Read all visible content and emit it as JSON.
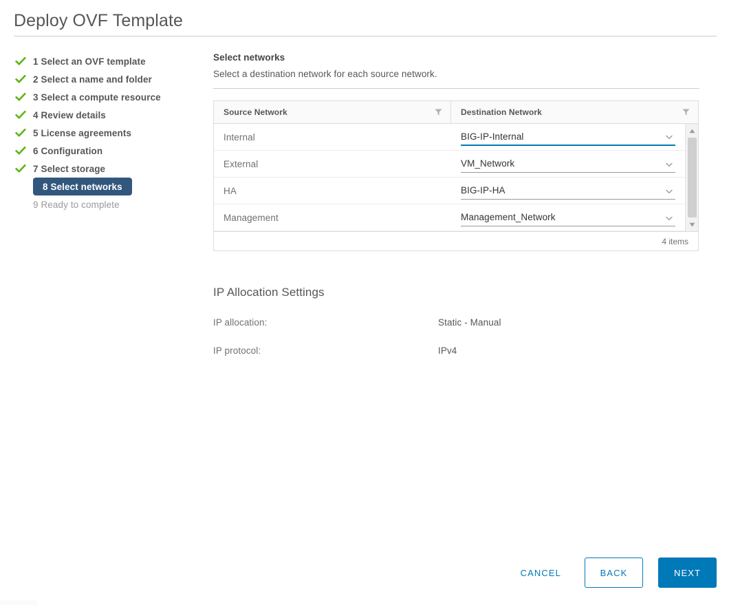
{
  "window": {
    "title": "Deploy OVF Template"
  },
  "steps": [
    {
      "number": "1",
      "label": "1 Select an OVF template",
      "state": "done"
    },
    {
      "number": "2",
      "label": "2 Select a name and folder",
      "state": "done"
    },
    {
      "number": "3",
      "label": "3 Select a compute resource",
      "state": "done"
    },
    {
      "number": "4",
      "label": "4 Review details",
      "state": "done"
    },
    {
      "number": "5",
      "label": "5 License agreements",
      "state": "done"
    },
    {
      "number": "6",
      "label": "6 Configuration",
      "state": "done"
    },
    {
      "number": "7",
      "label": "7 Select storage",
      "state": "done"
    },
    {
      "number": "8",
      "label": "8 Select networks",
      "state": "active"
    },
    {
      "number": "9",
      "label": "9 Ready to complete",
      "state": "pending"
    }
  ],
  "panel": {
    "title": "Select networks",
    "subtitle": "Select a destination network for each source network."
  },
  "table": {
    "columns": {
      "source": "Source Network",
      "destination": "Destination Network"
    },
    "rows": [
      {
        "source": "Internal",
        "destination": "BIG-IP-Internal",
        "focused": true
      },
      {
        "source": "External",
        "destination": "VM_Network",
        "focused": false
      },
      {
        "source": "HA",
        "destination": "BIG-IP-HA",
        "focused": false
      },
      {
        "source": "Management",
        "destination": "Management_Network",
        "focused": false
      }
    ],
    "footer_count": "4 items"
  },
  "ip_settings": {
    "heading": "IP Allocation Settings",
    "allocation_label": "IP allocation:",
    "allocation_value": "Static - Manual",
    "protocol_label": "IP protocol:",
    "protocol_value": "IPv4"
  },
  "footer": {
    "cancel_label": "CANCEL",
    "back_label": "BACK",
    "next_label": "NEXT"
  },
  "colors": {
    "accent_blue": "#0079b8",
    "active_step_bg": "#31577d",
    "check_green": "#60b515",
    "text_primary": "#565656",
    "text_muted": "#9a9a9a"
  }
}
